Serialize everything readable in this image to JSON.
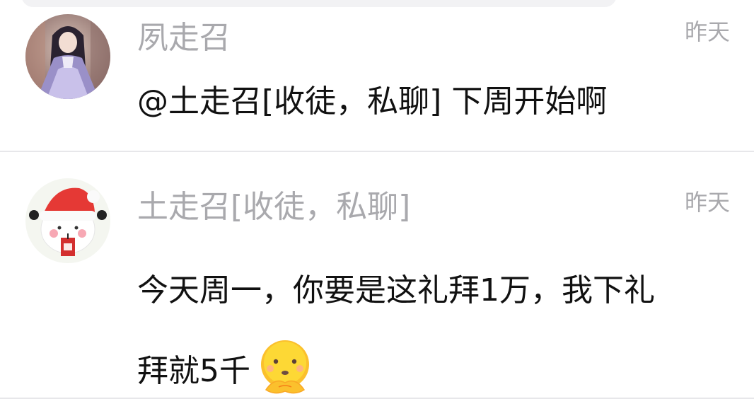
{
  "comments": [
    {
      "username": "夙走召",
      "timestamp": "昨天",
      "content": "@土走召[收徒，私聊] 下周开始啊",
      "avatar_icon": "girl-in-lavender-dress-avatar"
    },
    {
      "username": "土走召[收徒，私聊]",
      "timestamp": "昨天",
      "content_line1": "今天周一，你要是这礼拜1万，我下礼",
      "content_line2": "拜就5千",
      "avatar_icon": "santa-hat-cartoon-avatar",
      "emoji_icon": "thinking-face-emoji"
    }
  ],
  "colors": {
    "username": "#a9a9ad",
    "timestamp": "#a9a9ad",
    "text": "#111111",
    "divider": "#e7e7ea",
    "emoji_yellow": "#fbc02d"
  }
}
